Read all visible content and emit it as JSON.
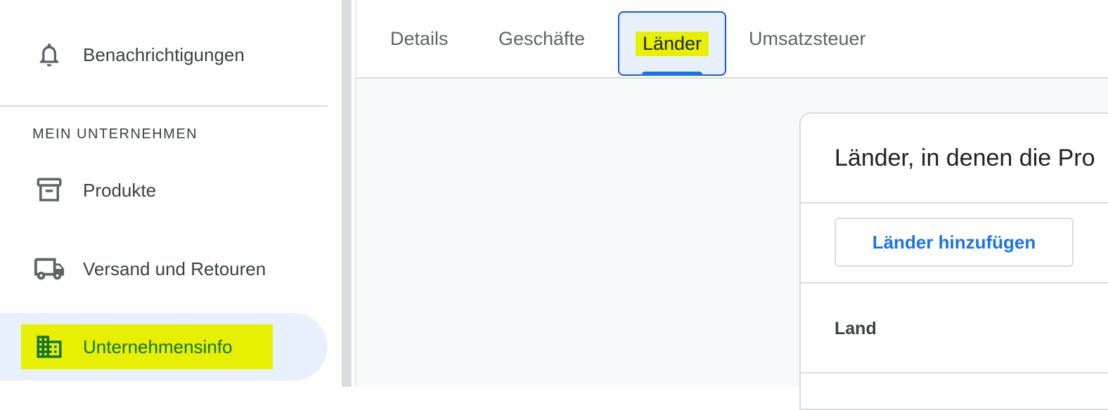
{
  "sidebar": {
    "notifications_label": "Benachrichtigungen",
    "section_title": "MEIN UNTERNEHMEN",
    "items": [
      {
        "label": "Produkte",
        "icon": "archive-icon"
      },
      {
        "label": "Versand und Retouren",
        "icon": "truck-icon"
      },
      {
        "label": "Unternehmensinfo",
        "icon": "business-icon",
        "active": true
      }
    ]
  },
  "tabs": [
    {
      "label": "Details"
    },
    {
      "label": "Geschäfte"
    },
    {
      "label": "Länder",
      "active": true
    },
    {
      "label": "Umsatzsteuer"
    }
  ],
  "card": {
    "title": "Länder, in denen die Pro",
    "add_button_label": "Länder hinzufügen",
    "column_header": "Land"
  },
  "colors": {
    "highlight": "#e6f000",
    "active_bg": "#e8f0fe",
    "accent": "#1a73e8",
    "active_text": "#137333"
  }
}
